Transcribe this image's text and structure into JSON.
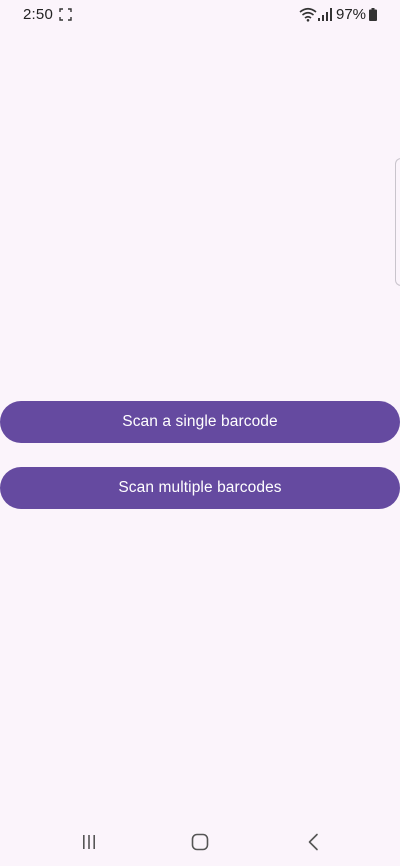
{
  "status_bar": {
    "time": "2:50",
    "battery_percent": "97%",
    "icons": [
      "screenshot-icon",
      "wifi-icon",
      "signal-icon",
      "battery-icon"
    ]
  },
  "main": {
    "buttons": [
      {
        "label": "Scan a single barcode"
      },
      {
        "label": "Scan multiple barcodes"
      }
    ]
  },
  "nav_bar": {
    "icons": [
      "recents-icon",
      "home-icon",
      "back-icon"
    ]
  },
  "colors": {
    "background": "#fbf4fb",
    "button_fill": "#654aa0",
    "button_text": "#ffffff"
  }
}
